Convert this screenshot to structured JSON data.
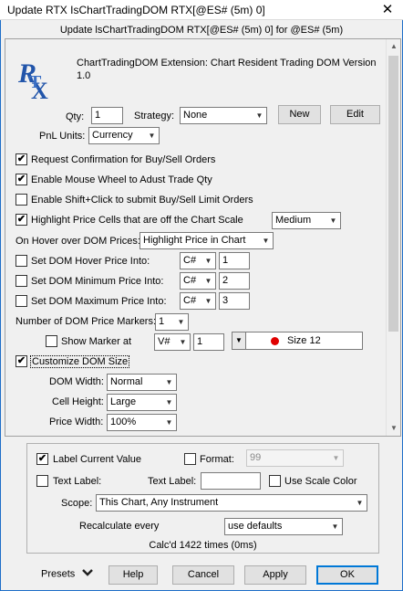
{
  "window": {
    "title": "Update RTX IsChartTradingDOM RTX[@ES# (5m) 0]",
    "close_icon": "close-icon",
    "header": "Update lsChartTradingDOM RTX[@ES# (5m) 0]  for  @ES# (5m)"
  },
  "study": {
    "logo_text": "RTX",
    "logo_color": "#2255aa",
    "description": "ChartTradingDOM Extension: Chart Resident Trading DOM Version 1.0"
  },
  "qty": {
    "label": "Qty:",
    "value": "1"
  },
  "strategy": {
    "label": "Strategy:",
    "value": "None"
  },
  "buttons": {
    "new": "New",
    "edit": "Edit"
  },
  "pnl": {
    "label": "PnL Units:",
    "value": "Currency"
  },
  "options": {
    "request_confirmation": {
      "label": "Request Confirmation for Buy/Sell Orders",
      "checked": "✔"
    },
    "mouse_wheel": {
      "label": "Enable Mouse Wheel to Adust Trade Qty",
      "checked": "✔"
    },
    "shift_click": {
      "label": "Enable Shift+Click to submit Buy/Sell Limit Orders",
      "checked": ""
    },
    "highlight_off_scale": {
      "label": "Highlight Price Cells that are off the Chart Scale",
      "checked": "✔",
      "value": "Medium"
    }
  },
  "hover": {
    "label": "On Hover over DOM Prices:",
    "value": "Highlight Price in Chart"
  },
  "dom_prices": {
    "hover": {
      "label": "Set DOM Hover Price Into:",
      "type": "C#",
      "value": "1"
    },
    "minimum": {
      "label": "Set DOM Minimum Price Into:",
      "type": "C#",
      "value": "2"
    },
    "maximum": {
      "label": "Set DOM Maximum Price Into:",
      "type": "C#",
      "value": "3"
    }
  },
  "markers": {
    "label": "Number of DOM Price Markers:",
    "count": "1",
    "show_label": "Show Marker at",
    "type": "V#",
    "value": "1",
    "marker_color": "#e00000",
    "marker_size": "Size 12"
  },
  "customize": {
    "label": "Customize DOM Size",
    "checked": "✔",
    "dom_width_label": "DOM Width:",
    "dom_width": "Normal",
    "cell_height_label": "Cell Height:",
    "cell_height": "Large",
    "price_width_label": "Price Width:",
    "price_width": "100%"
  },
  "label_group": {
    "label_current": {
      "label": "Label Current Value",
      "checked": "✔"
    },
    "format": {
      "label": "Format:",
      "value": "99",
      "checked": ""
    },
    "text_label_cb": {
      "label": "Text Label:",
      "checked": ""
    },
    "text_label_field": {
      "label": "Text Label:",
      "value": ""
    },
    "use_scale_color": {
      "label": "Use Scale Color",
      "checked": ""
    },
    "scope": {
      "label": "Scope:",
      "value": "This Chart, Any Instrument"
    },
    "recalc": {
      "label": "Recalculate every",
      "value": "use defaults"
    },
    "calc_status": "Calc'd 1422 times (0ms)"
  },
  "footer": {
    "presets": "Presets",
    "presets_icon": "chevron-down-icon",
    "help": "Help",
    "cancel": "Cancel",
    "apply": "Apply",
    "ok": "OK"
  }
}
